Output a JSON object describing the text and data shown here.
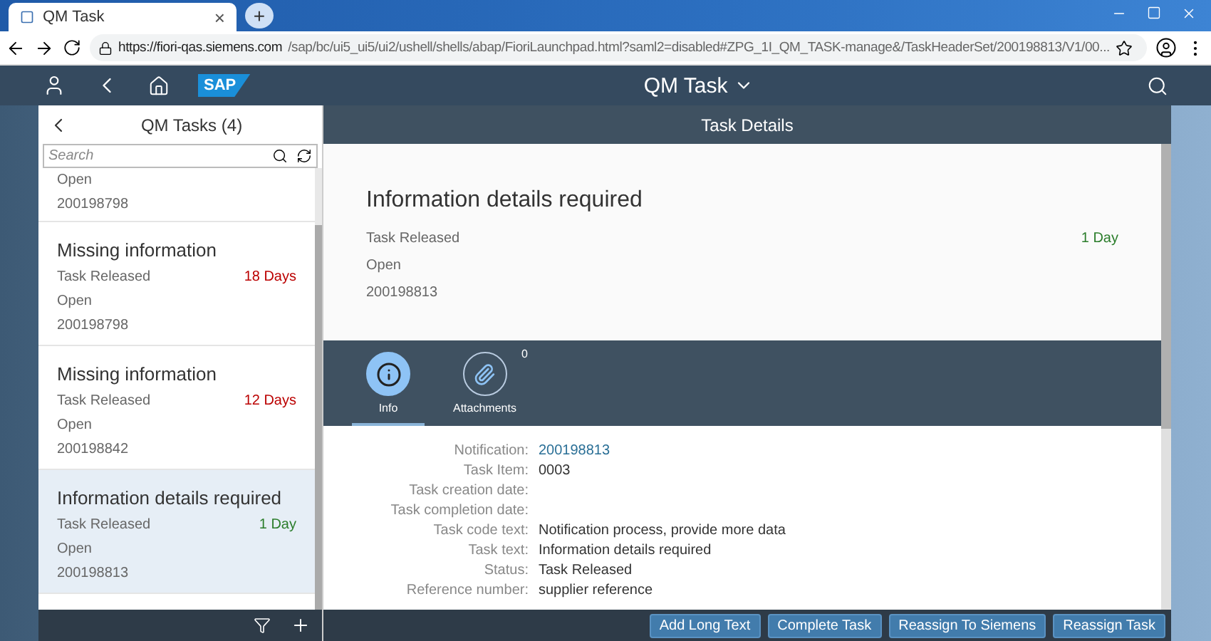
{
  "browser": {
    "tab_title": "QM Task",
    "tab_close": "×",
    "new_tab": "+",
    "url_host": "https://fiori-qas.siemens.com",
    "url_path": "/sap/bc/ui5_ui5/ui2/ushell/shells/abap/FioriLaunchpad.html?saml2=disabled#ZPG_1I_QM_TASK-manage&/TaskHeaderSet/200198813/V1/00..."
  },
  "shell": {
    "logo": "SAP",
    "title": "QM Task"
  },
  "master": {
    "title": "QM Tasks (4)",
    "search": {
      "placeholder": "Search"
    },
    "items": [
      {
        "state": "Open",
        "number": "200198798",
        "selected": false
      },
      {
        "title": "Missing information",
        "status": "Task Released",
        "due": "18 Days",
        "color": "#bb0000",
        "state": "Open",
        "number": "200198798",
        "selected": false
      },
      {
        "title": "Missing information",
        "status": "Task Released",
        "due": "12 Days",
        "color": "#bb0000",
        "state": "Open",
        "number": "200198842",
        "selected": false
      },
      {
        "title": "Information details required",
        "status": "Task Released",
        "due": "1 Day",
        "color": "#2b7d2b",
        "state": "Open",
        "number": "200198813",
        "selected": true
      }
    ]
  },
  "detail": {
    "title": "Task Details",
    "header": {
      "title": "Information details required",
      "status": "Task Released",
      "due": "1 Day",
      "state": "Open",
      "number": "200198813"
    },
    "tabs": [
      {
        "kind": "info",
        "label": "Info",
        "selected": true
      },
      {
        "kind": "attachments",
        "label": "Attachments",
        "count": "0",
        "selected": false
      }
    ],
    "fields": [
      {
        "label": "Notification:",
        "value": "200198813",
        "kind": "link"
      },
      {
        "label": "Task Item:",
        "value": "0003",
        "kind": "text"
      },
      {
        "label": "Task creation date:"
      },
      {
        "label": "Task completion date:"
      },
      {
        "label": "Task code text:",
        "value": "Notification process, provide more data",
        "kind": "text"
      },
      {
        "label": "Task text:",
        "value": "Information details required",
        "kind": "text"
      },
      {
        "label": "Status:",
        "value": "Task Released",
        "kind": "text"
      },
      {
        "label": "Reference number:",
        "value": "supplier reference",
        "kind": "text"
      }
    ],
    "buttons": [
      "Add Long Text",
      "Complete Task",
      "Reassign To Siemens",
      "Reassign Task"
    ]
  }
}
